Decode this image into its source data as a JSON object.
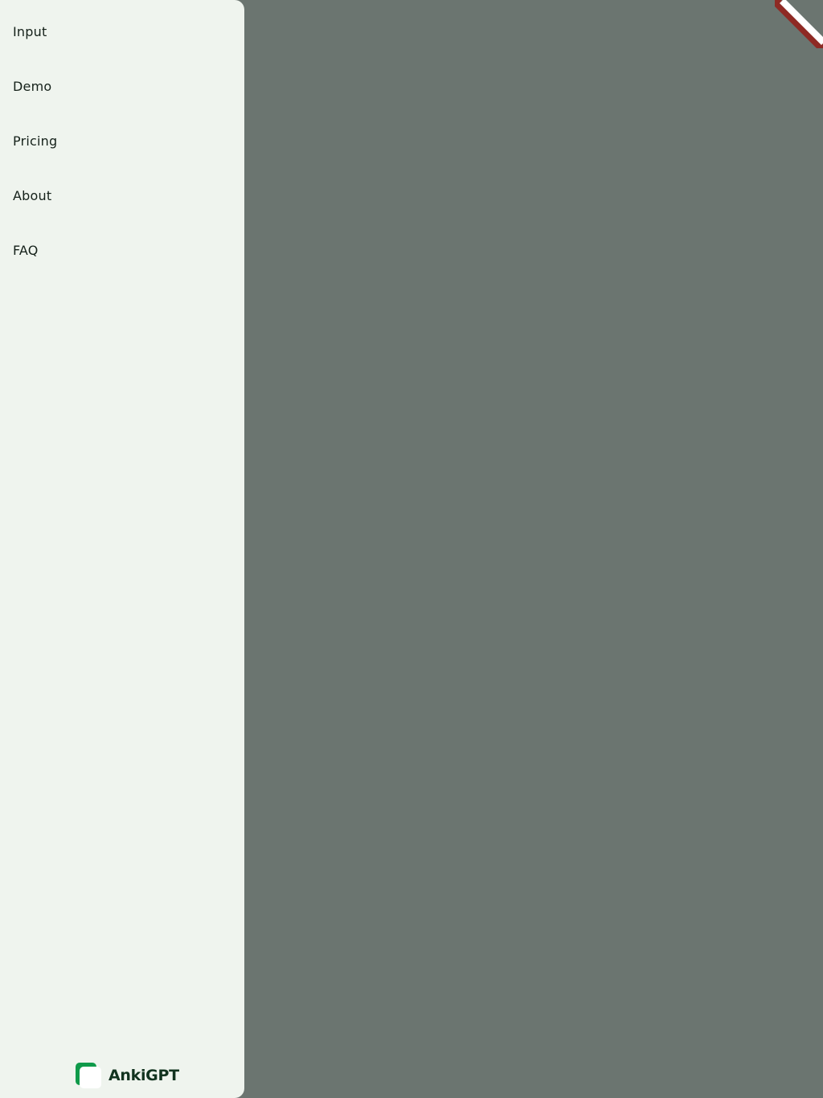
{
  "drawer": {
    "items": [
      {
        "label": "Input"
      },
      {
        "label": "Demo"
      },
      {
        "label": "Pricing"
      },
      {
        "label": "About"
      },
      {
        "label": "FAQ"
      }
    ]
  },
  "brand": {
    "name": "AnkiGPT",
    "logo_icon": "stacked-cards-logo-icon"
  },
  "colors": {
    "drawer_bg": "#eff4ee",
    "overlay": "#6b7570",
    "brand_green": "#0f9a4a",
    "ribbon_red": "#8e2a24"
  }
}
